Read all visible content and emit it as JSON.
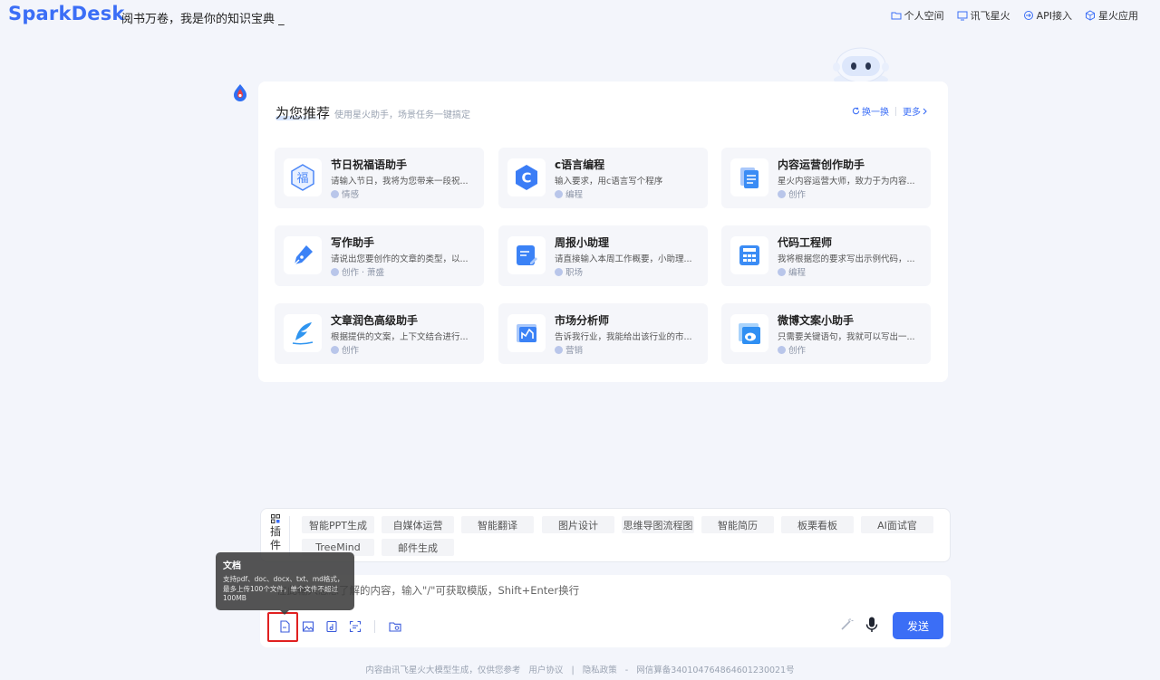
{
  "header": {
    "logo": "SparkDesk",
    "slogan": "阅书万卷，我是你的知识宝典 _",
    "nav": [
      {
        "label": "个人空间",
        "icon": "folder-icon"
      },
      {
        "label": "讯飞星火",
        "icon": "monitor-icon"
      },
      {
        "label": "API接入",
        "icon": "api-icon"
      },
      {
        "label": "星火应用",
        "icon": "cube-icon"
      }
    ]
  },
  "recommend": {
    "title": "为您推荐",
    "subtitle": "使用星火助手，场景任务一键搞定",
    "refresh_label": "换一换",
    "more_label": "更多",
    "cards": [
      {
        "title": "节日祝福语助手",
        "desc": "请输入节日，我将为您带来一段祝...",
        "tag": "情感",
        "icon": "blessing-icon",
        "color": "#4a86f7"
      },
      {
        "title": "c语言编程",
        "desc": "输入要求，用c语言写个程序",
        "tag": "编程",
        "icon": "c-language-icon",
        "color": "#3b7df6"
      },
      {
        "title": "内容运营创作助手",
        "desc": "星火内容运营大师，致力于为内容...",
        "tag": "创作",
        "icon": "document-stack-icon",
        "color": "#3a8cf5"
      },
      {
        "title": "写作助手",
        "desc": "请说出您要创作的文章的类型，以...",
        "tag": "创作 · 萧盛",
        "icon": "pen-icon",
        "color": "#3b82f6"
      },
      {
        "title": "周报小助理",
        "desc": "请直接输入本周工作概要，小助理...",
        "tag": "职场",
        "icon": "report-edit-icon",
        "color": "#3b82f6"
      },
      {
        "title": "代码工程师",
        "desc": "我将根据您的要求写出示例代码，...",
        "tag": "编程",
        "icon": "calculator-icon",
        "color": "#3b8cf5"
      },
      {
        "title": "文章润色高级助手",
        "desc": "根据提供的文案，上下文结合进行...",
        "tag": "创作",
        "icon": "feather-icon",
        "color": "#2f95f0"
      },
      {
        "title": "市场分析师",
        "desc": "告诉我行业，我能给出该行业的市...",
        "tag": "营销",
        "icon": "chart-board-icon",
        "color": "#3b82f6"
      },
      {
        "title": "微博文案小助手",
        "desc": "只需要关键语句，我就可以写出一...",
        "tag": "创作",
        "icon": "weibo-icon",
        "color": "#2f8ff3"
      }
    ]
  },
  "plugins": {
    "label": "插件",
    "items": [
      "智能PPT生成",
      "自媒体运营",
      "智能翻译",
      "图片设计",
      "思维导图流程图",
      "智能简历",
      "板栗看板",
      "AI面试官",
      "TreeMind",
      "邮件生成"
    ]
  },
  "input": {
    "placeholder": "在此输入您想了解的内容，输入\"/\"可获取模版，Shift+Enter换行",
    "send_label": "发送"
  },
  "tooltip": {
    "title": "文档",
    "body": "支持pdf、doc、docx、txt、md格式，最多上传100个文件，单个文件不超过100MB"
  },
  "footer": {
    "notice": "内容由讯飞星火大模型生成，仅供您参考",
    "agreement": "用户协议",
    "privacy": "隐私政策",
    "record": "网信算备340104764864601230021号"
  },
  "colors": {
    "accent": "#3b6ef6",
    "highlight": "#e02020"
  }
}
